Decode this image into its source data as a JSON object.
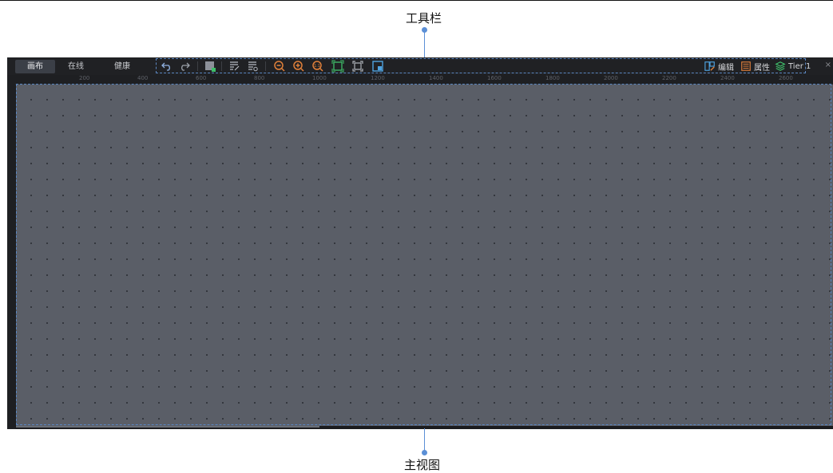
{
  "annotations": {
    "toolbar_label": "工具栏",
    "main_view_label": "主视图"
  },
  "toolbar": {
    "tabs": [
      {
        "label": "画布",
        "active": true
      },
      {
        "label": "在线",
        "active": false
      },
      {
        "label": "健康",
        "active": false
      }
    ],
    "tools": [
      {
        "icon": "undo-icon"
      },
      {
        "icon": "redo-icon"
      },
      {
        "icon": "add-node-icon"
      },
      {
        "icon": "edit-note-icon"
      },
      {
        "icon": "edit-list-icon"
      },
      {
        "icon": "zoom-out-icon"
      },
      {
        "icon": "zoom-in-icon"
      },
      {
        "icon": "zoom-reset-icon"
      },
      {
        "icon": "fit-view-icon"
      },
      {
        "icon": "fullscreen-icon"
      },
      {
        "icon": "minimap-icon"
      }
    ],
    "right": {
      "edit_label": "编辑",
      "properties_label": "属性",
      "tier_label": "Tier 1"
    },
    "close_symbol": "×"
  },
  "ruler": {
    "ticks": [
      "200",
      "400",
      "600",
      "800",
      "1000",
      "1200",
      "1400",
      "1600",
      "1800",
      "2000",
      "2200",
      "2400",
      "2600"
    ]
  },
  "colors": {
    "accent": "#5b8fd6",
    "zoom": "#e0803a",
    "fit": "#3fbf6a",
    "canvas": "#5a5e67",
    "background": "#1b1c1f"
  }
}
